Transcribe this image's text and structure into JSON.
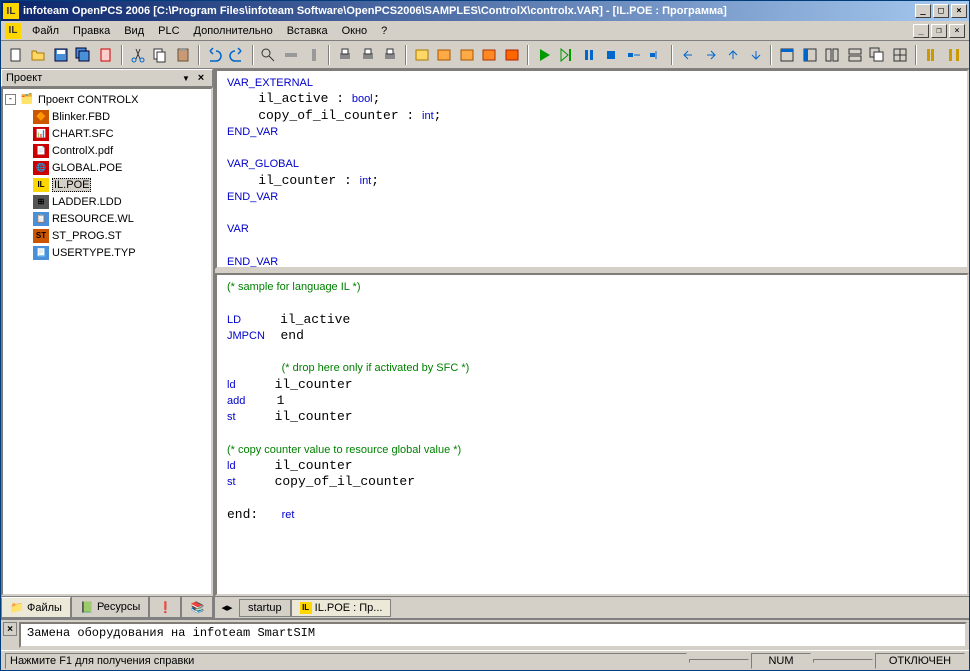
{
  "title": "infoteam OpenPCS 2006 [C:\\Program Files\\infoteam Software\\OpenPCS2006\\SAMPLES\\ControlX\\controlx.VAR]  - [IL.POE : Программа]",
  "app_icon": "IL",
  "menu": [
    "Файл",
    "Правка",
    "Вид",
    "PLC",
    "Дополнительно",
    "Вставка",
    "Окно",
    "?"
  ],
  "sidebar": {
    "title": "Проект",
    "root": "Проект CONTROLX",
    "items": [
      {
        "label": "Blinker.FBD",
        "icon": "🔶",
        "color": "#cc5500"
      },
      {
        "label": "CHART.SFC",
        "icon": "📊",
        "color": "#cc0000"
      },
      {
        "label": "ControlX.pdf",
        "icon": "📄",
        "color": "#cc0000"
      },
      {
        "label": "GLOBAL.POE",
        "icon": "🌐",
        "color": "#cc0000"
      },
      {
        "label": "IL.POE",
        "icon": "IL",
        "color": "#ffd700",
        "selected": true
      },
      {
        "label": "LADDER.LDD",
        "icon": "⊞",
        "color": "#555"
      },
      {
        "label": "RESOURCE.WL",
        "icon": "📋",
        "color": "#4a90d9"
      },
      {
        "label": "ST_PROG.ST",
        "icon": "ST",
        "color": "#cc5500"
      },
      {
        "label": "USERTYPE.TYP",
        "icon": "📃",
        "color": "#4a90d9"
      }
    ],
    "tabs": [
      {
        "label": "Файлы",
        "icon": "📁",
        "active": true
      },
      {
        "label": "Ресурсы",
        "icon": "📗"
      },
      {
        "label": "",
        "icon": "❗"
      },
      {
        "label": "",
        "icon": "📚"
      }
    ]
  },
  "editor": {
    "top_code": "<span class=\"kw\">VAR_EXTERNAL</span>\n    il_active : <span class=\"kw\">bool</span>;\n    copy_of_il_counter : <span class=\"kw\">int</span>;\n<span class=\"kw\">END_VAR</span>\n\n<span class=\"kw\">VAR_GLOBAL</span>\n    il_counter : <span class=\"kw\">int</span>;\n<span class=\"kw\">END_VAR</span>\n\n<span class=\"kw\">VAR</span>\n\n<span class=\"kw\">END_VAR</span>",
    "bottom_code": "<span class=\"cm\">(* sample for language IL *)</span>\n\n<span class=\"op\">LD</span>     il_active\n<span class=\"op\">JMPCN</span>  end\n\n       <span class=\"cm\">(* drop here only if activated by SFC *)</span>\n<span class=\"op\">ld</span>     il_counter\n<span class=\"op\">add</span>    1\n<span class=\"op\">st</span>     il_counter\n\n<span class=\"cm\">(* copy counter value to resource global value *)</span>\n<span class=\"op\">ld</span>     il_counter\n<span class=\"op\">st</span>     copy_of_il_counter\n\nend:   <span class=\"op\">ret</span>",
    "tabs": [
      {
        "label": "startup",
        "active": false
      },
      {
        "label": "IL.POE : Пр...",
        "active": true,
        "icon": "IL"
      }
    ]
  },
  "output": "Замена оборудования на infoteam SmartSIM",
  "status": {
    "text": "Нажмите F1 для получения справки",
    "num": "NUM",
    "conn": "ОТКЛЮЧЕН"
  }
}
